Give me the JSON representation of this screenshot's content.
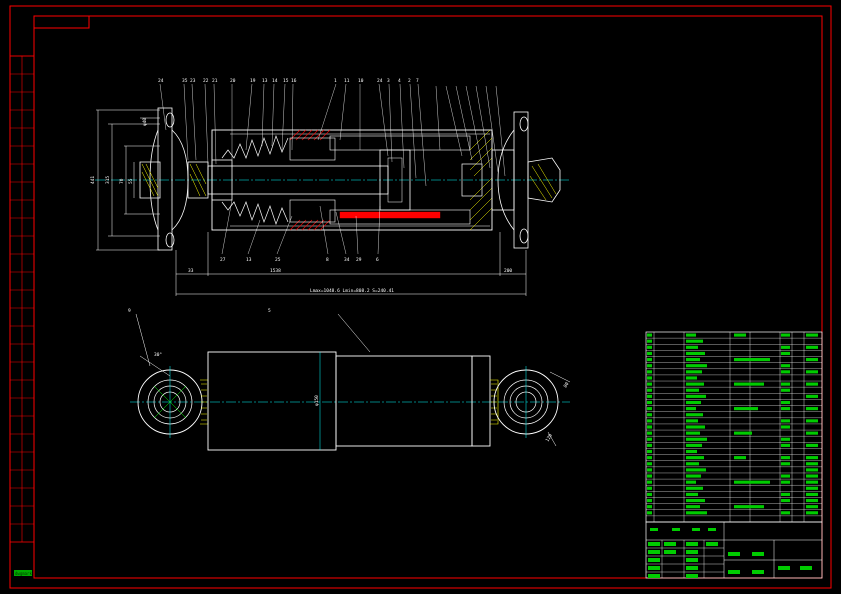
{
  "colors": {
    "background": "#000000",
    "frame": "#ff0000",
    "outline": "#ffffff",
    "centerline": "#00ffff",
    "table_text": "#00ff00",
    "section_fill": "#ff0000",
    "hatch": "#ffff00"
  },
  "top_view": {
    "balloon_labels_top": [
      "24",
      "35",
      "23",
      "22",
      "21",
      "20",
      "19",
      "13",
      "14",
      "15",
      "16",
      "1",
      "11",
      "10",
      "24",
      "3",
      "4",
      "2",
      "7"
    ],
    "balloon_labels_bottom": [
      "27",
      "13",
      "25",
      "8",
      "34",
      "29",
      "6"
    ],
    "dimensions": {
      "left_a": "441",
      "left_b": "315",
      "left_c": "70",
      "left_d": "55",
      "left_top": "φ40",
      "bottom_short_left": "33",
      "bottom_mid": "1538",
      "bottom_right": "200",
      "overall_text": "Lmax=1048.6  Lmin=808.2  S=240.41"
    }
  },
  "bottom_view": {
    "labels": [
      "9",
      "5"
    ],
    "dimensions": {
      "left_angle": "30°",
      "body_dia": "φ150",
      "right_a": "80",
      "right_b": "120"
    }
  },
  "parts_table": {
    "rows_count": 30
  },
  "title_block": {
    "label": ""
  },
  "corner_stamp": "dwgmark"
}
